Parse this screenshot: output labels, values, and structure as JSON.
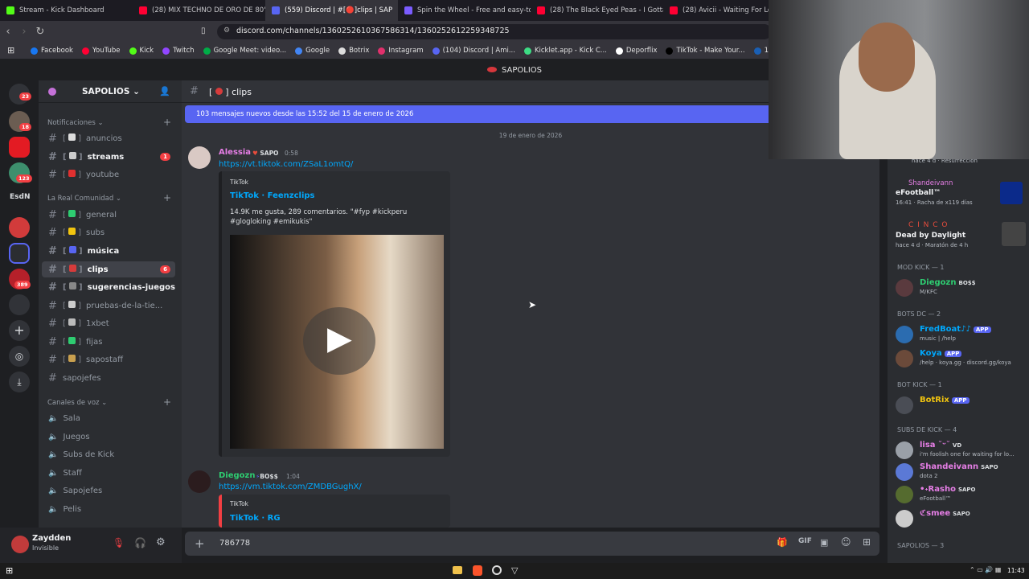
{
  "browser": {
    "tabs": [
      {
        "label": "Stream - Kick Dashboard",
        "color": "#53fc18"
      },
      {
        "label": "(28) MIX TECHNO DE ORO DE 80's &",
        "color": "#ff0033"
      },
      {
        "label": "(559) Discord | #[🔴]clips | SAP",
        "color": "#5865f2"
      },
      {
        "label": "Spin the Wheel - Free and easy-to-u",
        "color": "#7b5cff"
      },
      {
        "label": "(28) The Black Eyed Peas - I Gotta Fe",
        "color": "#ff0033"
      },
      {
        "label": "(28) Avicii - Waiting For Love (Ly",
        "color": "#ff0033"
      }
    ],
    "url": "discord.com/channels/1360252610367586314/1360252612259348725",
    "bookmarks": [
      {
        "label": "Facebook",
        "color": "#1877f2"
      },
      {
        "label": "YouTube",
        "color": "#ff0033"
      },
      {
        "label": "Kick",
        "color": "#53fc18"
      },
      {
        "label": "Twitch",
        "color": "#9146ff"
      },
      {
        "label": "Google Meet: video...",
        "color": "#00ac47"
      },
      {
        "label": "Google",
        "color": "#4285f4"
      },
      {
        "label": "Botrix",
        "color": "#dddddd"
      },
      {
        "label": "Instagram",
        "color": "#e1306c"
      },
      {
        "label": "(104) Discord | Ami...",
        "color": "#5865f2"
      },
      {
        "label": "Kicklet.app - Kick C...",
        "color": "#3ddc84"
      },
      {
        "label": "Deporflix",
        "color": "#ffffff"
      },
      {
        "label": "TikTok - Make Your...",
        "color": "#000000"
      },
      {
        "label": "1xBet ⊳ Apues",
        "color": "#1a5fb4"
      }
    ]
  },
  "app_title": "SAPOLIOS",
  "servers": {
    "badges": [
      "23",
      "18",
      "123",
      "EsdN",
      "389"
    ]
  },
  "sidebar": {
    "server_name": "SAPOLIOS",
    "categories": [
      "Notificaciones",
      "La Real Comunidad",
      "Canales de voz"
    ],
    "channels": [
      {
        "label": "anuncios",
        "badge": "",
        "unread": false,
        "selected": false
      },
      {
        "label": "streams",
        "badge": "1",
        "unread": true,
        "selected": false
      },
      {
        "label": "youtube",
        "badge": "",
        "unread": false,
        "selected": false
      },
      {
        "label": "general",
        "badge": "",
        "unread": false,
        "selected": false
      },
      {
        "label": "subs",
        "badge": "",
        "unread": false,
        "selected": false
      },
      {
        "label": "música",
        "badge": "",
        "unread": true,
        "selected": false
      },
      {
        "label": "clips",
        "badge": "6",
        "unread": true,
        "selected": true
      },
      {
        "label": "sugerencias-juegos",
        "badge": "",
        "unread": true,
        "selected": false
      },
      {
        "label": "pruebas-de-la-tie...",
        "badge": "",
        "unread": false,
        "selected": false
      },
      {
        "label": "1xbet",
        "badge": "",
        "unread": false,
        "selected": false
      },
      {
        "label": "fijas",
        "badge": "",
        "unread": false,
        "selected": false
      },
      {
        "label": "sapostaff",
        "badge": "",
        "unread": false,
        "selected": false
      },
      {
        "label": "sapojefes",
        "badge": "",
        "unread": false,
        "selected": false
      }
    ],
    "voice": [
      "Sala",
      "Juegos",
      "Subs de Kick",
      "Staff",
      "Sapojefes",
      "Pelis"
    ]
  },
  "user": {
    "name": "Zaydden",
    "status": "Invisible"
  },
  "chat": {
    "channel": "clips",
    "new_messages": "103 mensajes nuevos desde las 15:52 del 15 de enero de 2026",
    "date": "19 de enero de 2026",
    "messages": [
      {
        "author": "Alessia",
        "tag": "SAPO",
        "time": "0:58",
        "link": "https://vt.tiktok.com/ZSaL1omtQ/",
        "embed_provider": "TikTok",
        "embed_title": "TikTok · Feenzclips",
        "embed_desc": "14.9K me gusta, 289 comentarios. \"#fyp #kickperu #glogloking #emikukis\""
      },
      {
        "author": "Diegozn",
        "tag": "BO$$",
        "time": "1:04",
        "link": "https://vm.tiktok.com/ZMDBGughX/",
        "embed_provider": "TikTok",
        "embed_title": "TikTok · RG"
      }
    ],
    "input_value": "786778"
  },
  "members": {
    "top_line": "hace 4 d · Resurrección",
    "activities": [
      {
        "name": "Shandeivann",
        "game": "eFootball™",
        "sub": "16:41 · Racha de x119 días"
      },
      {
        "name": "C I N C O",
        "game": "Dead by Daylight",
        "sub": "hace 4 d · Maratón de 4 h"
      }
    ],
    "groups": [
      {
        "title": "MOD KICK — 1",
        "rows": [
          {
            "name": "Diegozn",
            "tag": "BO$$",
            "sub": "M/KFC",
            "color": "#2ecc71"
          }
        ]
      },
      {
        "title": "BOTS DC — 2",
        "rows": [
          {
            "name": "FredBoat♪♪",
            "tag": "APP",
            "sub": "music | /help",
            "color": "#00a8fc"
          },
          {
            "name": "Koya",
            "tag": "APP",
            "sub": "/help · koya.gg · discord.gg/koya",
            "color": "#00a8fc"
          }
        ]
      },
      {
        "title": "BOT KICK — 1",
        "rows": [
          {
            "name": "BotRix",
            "tag": "APP",
            "sub": "",
            "color": "#f1c40f"
          }
        ]
      },
      {
        "title": "SUBS DE KICK — 4",
        "rows": [
          {
            "name": "lisa ˘ᵕ˘",
            "tag": "VD",
            "sub": "i'm foolish one for waiting for lo...",
            "color": "#e67ee6"
          },
          {
            "name": "Shandeivann",
            "tag": "SAPO",
            "sub": "dota 2",
            "color": "#e67ee6"
          },
          {
            "name": "•˖Rasho",
            "tag": "SAPO",
            "sub": "eFootball™",
            "color": "#e67ee6"
          },
          {
            "name": "ℭsmee",
            "tag": "SAPO",
            "sub": "",
            "color": "#e67ee6"
          }
        ]
      },
      {
        "title": "SAPOLIOS — 3",
        "rows": []
      }
    ]
  },
  "taskbar": {
    "time": "11:43"
  }
}
